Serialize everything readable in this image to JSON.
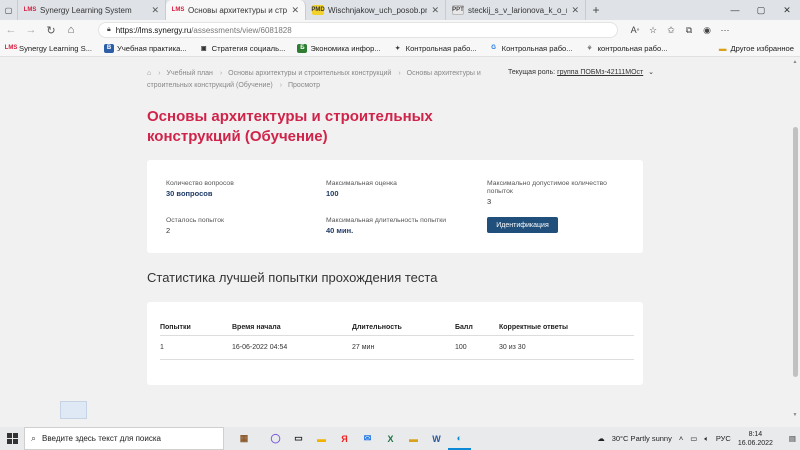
{
  "browser": {
    "tabs": [
      {
        "icon": "LMS",
        "title": "Synergy Learning System",
        "active": false
      },
      {
        "icon": "LMS",
        "title": "Основы архитектуры и строите",
        "active": true
      },
      {
        "icon": "PMD",
        "title": "Wischnjakow_uch_posob.pmd",
        "active": false
      },
      {
        "icon": "PPT",
        "title": "steckij_s_v_larionova_k_o_nikon",
        "active": false
      }
    ],
    "new_tab": "+",
    "url_host": "https://lms.synergy.ru",
    "url_path": "/assessments/view/6081828",
    "favorites": [
      {
        "icon": "LMS",
        "label": "Synergy Learning S..."
      },
      {
        "icon": "B",
        "label": "Учебная практика..."
      },
      {
        "icon": "▣",
        "label": "Стратегия социаль..."
      },
      {
        "icon": "Б",
        "label": "Экономика инфор..."
      },
      {
        "icon": "✦",
        "label": "Контрольная рабо..."
      },
      {
        "icon": "G",
        "label": "Контрольная рабо..."
      },
      {
        "icon": "⚘",
        "label": "контрольная рабо..."
      }
    ],
    "favorites_other": "Другое избранное"
  },
  "page": {
    "breadcrumb": [
      "Учебный план",
      "Основы архитектуры и строительных конструкций",
      "Основы архитектуры и строительных конструкций (Обучение)",
      "Просмотр"
    ],
    "role_label": "Текущая роль:",
    "role_value": "группа ПОБМз-42111МОст",
    "title": "Основы архитектуры и строительных конструкций (Обучение)",
    "info": {
      "questions_label": "Количество вопросов",
      "questions_value": "30 вопросов",
      "max_score_label": "Максимальная оценка",
      "max_score_value": "100",
      "max_attempts_label": "Максимально допустимое количество попыток",
      "max_attempts_value": "3",
      "remaining_label": "Осталось попыток",
      "remaining_value": "2",
      "max_duration_label": "Максимальная длительность попытки",
      "max_duration_value": "40 мин.",
      "identify_button": "Идентификация"
    },
    "stats_title": "Статистика лучшей попытки прохождения теста",
    "table": {
      "headers": [
        "Попытки",
        "Время начала",
        "Длительность",
        "Балл",
        "Корректные ответы"
      ],
      "rows": [
        [
          "1",
          "16-06-2022 04:54",
          "27 мин",
          "100",
          "30 из 30"
        ]
      ]
    }
  },
  "taskbar": {
    "search_placeholder": "Введите здесь текст для поиска",
    "weather": "30°C  Partly sunny",
    "lang": "РУС",
    "time": "8:14",
    "date": "16.06.2022"
  },
  "colors": {
    "accent_title": "#d0234a",
    "button": "#1f4f7a",
    "value_text": "#1f3b66"
  }
}
